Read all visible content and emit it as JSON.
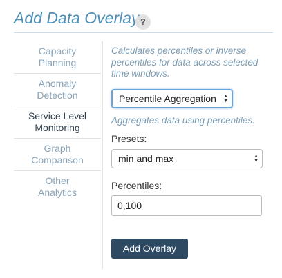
{
  "header": {
    "title": "Add Data Overlay",
    "help_label": "?"
  },
  "sidebar": {
    "items": [
      {
        "line1": "Capacity",
        "line2": "Planning",
        "active": false
      },
      {
        "line1": "Anomaly",
        "line2": "Detection",
        "active": false
      },
      {
        "line1": "Service Level",
        "line2": "Monitoring",
        "active": true
      },
      {
        "line1": "Graph",
        "line2": "Comparison",
        "active": false
      },
      {
        "line1": "Other",
        "line2": "Analytics",
        "active": false
      }
    ]
  },
  "main": {
    "description": "Calculates percentiles or inverse percentiles for data across selected time windows.",
    "aggregation_select": {
      "value": "Percentile Aggregation"
    },
    "aggregation_description": "Aggregates data using percentiles.",
    "presets_label": "Presets:",
    "presets_select": {
      "value": "min and max"
    },
    "percentiles_label": "Percentiles:",
    "percentiles_input": {
      "value": "0,100"
    },
    "submit_label": "Add Overlay"
  },
  "colors": {
    "title": "#4f8fb5",
    "sidebar_inactive": "#8aa4b8",
    "sidebar_active": "#2f3e4b",
    "button_bg": "#2e4a62",
    "focus_border": "#6aa4d8"
  }
}
